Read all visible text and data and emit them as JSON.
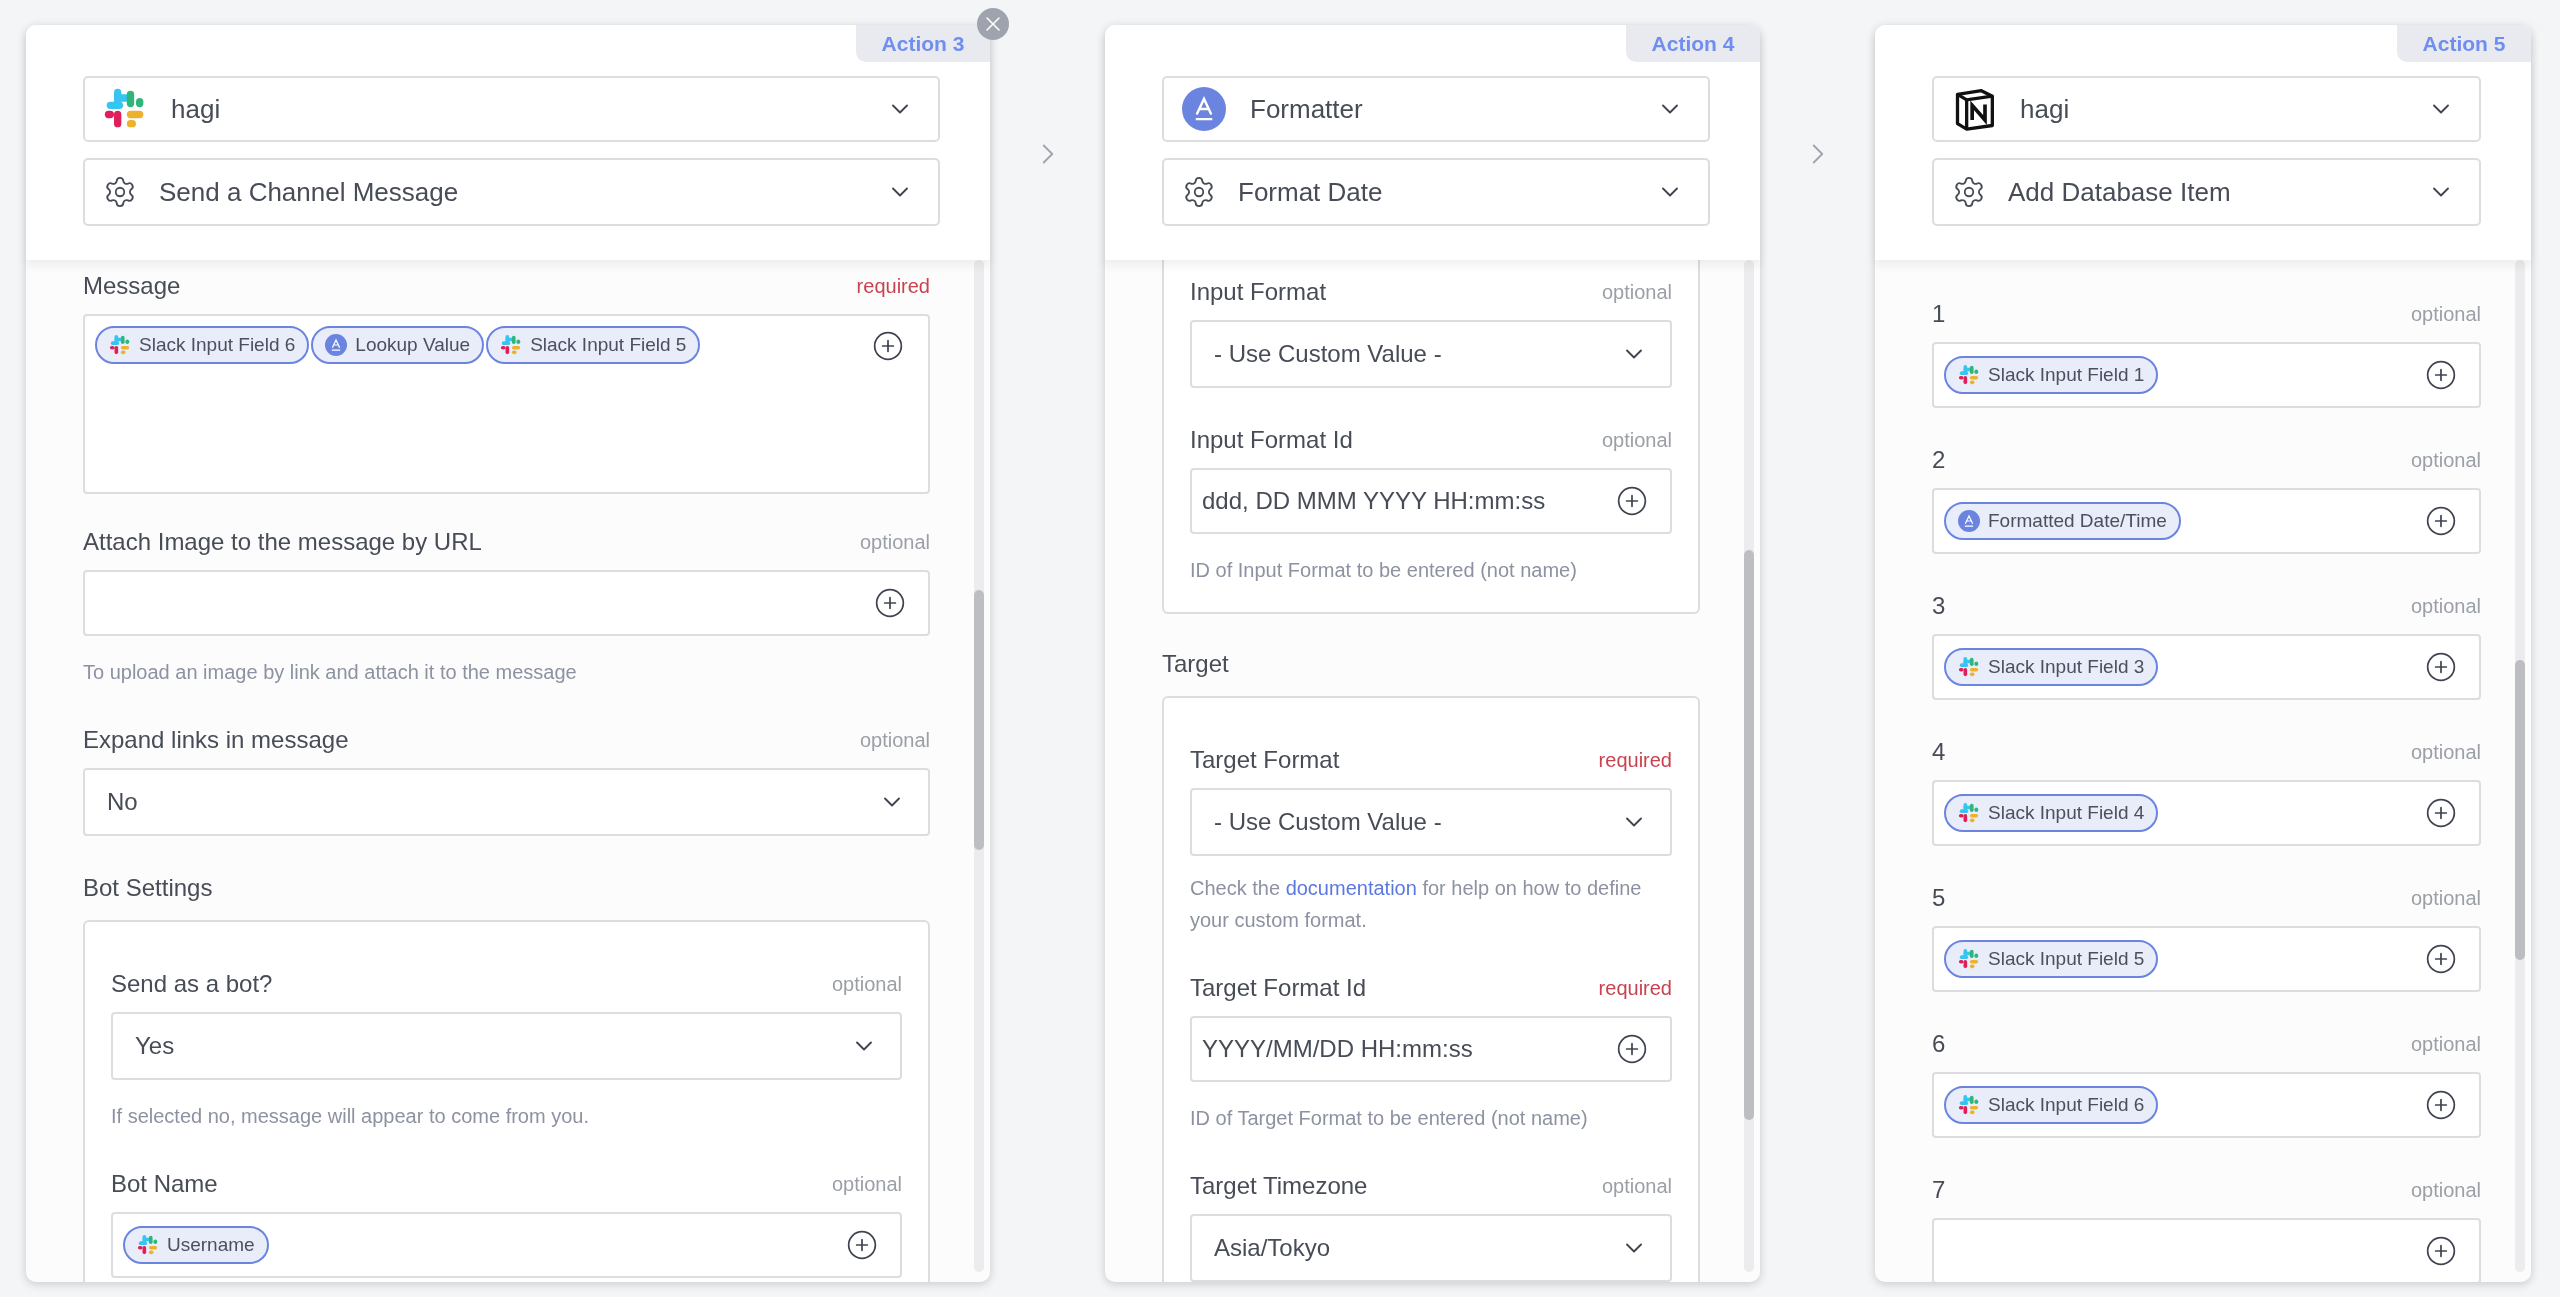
{
  "panels": [
    {
      "action": "Action 3",
      "closable": true,
      "app": {
        "kind": "slack",
        "name": "hagi"
      },
      "event": "Send a Channel Message",
      "fields": [
        {
          "kind": "tokens",
          "label": "Message",
          "required": true,
          "badge": "required",
          "tokens": [
            {
              "kind": "slack",
              "text": "Slack Input Field 6"
            },
            {
              "kind": "formatter",
              "text": "Lookup Value"
            },
            {
              "kind": "slack",
              "text": "Slack Input Field 5"
            }
          ]
        },
        {
          "kind": "input",
          "label": "Attach Image to the message by URL",
          "required": false,
          "badge": "optional",
          "hint": "To upload an image by link and attach it to the message"
        },
        {
          "kind": "select",
          "label": "Expand links in message",
          "required": false,
          "badge": "optional",
          "value": "No"
        },
        {
          "kind": "group",
          "title": "Bot Settings",
          "children": [
            {
              "kind": "select",
              "label": "Send as a bot?",
              "required": false,
              "badge": "optional",
              "value": "Yes",
              "hint": "If selected no, message will appear to come from you."
            },
            {
              "kind": "input",
              "label": "Bot Name",
              "required": false,
              "badge": "optional",
              "tokens": [
                {
                  "kind": "slack",
                  "text": "Username"
                }
              ]
            }
          ]
        }
      ]
    },
    {
      "action": "Action 4",
      "closable": false,
      "app": {
        "kind": "formatter",
        "name": "Formatter"
      },
      "event": "Format Date",
      "fields": [
        {
          "kind": "group",
          "children": [
            {
              "kind": "select",
              "label": "Input Format",
              "required": false,
              "badge": "optional",
              "value": "- Use Custom Value -"
            },
            {
              "kind": "input",
              "label": "Input Format Id",
              "required": false,
              "badge": "optional",
              "value": "ddd, DD MMM YYYY HH:mm:ss",
              "hint": "ID of Input Format to be entered (not name)"
            }
          ]
        },
        {
          "kind": "group",
          "title": "Target",
          "children": [
            {
              "kind": "select",
              "label": "Target Format",
              "required": true,
              "badge": "required",
              "value": "- Use Custom Value -",
              "hint_link": {
                "before": "Check the",
                "link": "documentation",
                "after": "for help on how to define your custom format."
              }
            },
            {
              "kind": "input",
              "label": "Target Format Id",
              "required": true,
              "badge": "required",
              "value": "YYYY/MM/DD HH:mm:ss",
              "hint": "ID of Target Format to be entered (not name)"
            },
            {
              "kind": "select",
              "label": "Target Timezone",
              "required": false,
              "badge": "optional",
              "value": "Asia/Tokyo"
            }
          ]
        }
      ]
    },
    {
      "action": "Action 5",
      "closable": false,
      "app": {
        "kind": "notion",
        "name": "hagi"
      },
      "event": "Add Database Item",
      "fields": [
        {
          "kind": "input",
          "label": "1",
          "required": false,
          "badge": "optional",
          "tokens": [
            {
              "kind": "slack",
              "text": "Slack Input Field 1"
            }
          ]
        },
        {
          "kind": "input",
          "label": "2",
          "required": false,
          "badge": "optional",
          "tokens": [
            {
              "kind": "formatter",
              "text": "Formatted Date/Time"
            }
          ]
        },
        {
          "kind": "input",
          "label": "3",
          "required": false,
          "badge": "optional",
          "tokens": [
            {
              "kind": "slack",
              "text": "Slack Input Field 3"
            }
          ]
        },
        {
          "kind": "input",
          "label": "4",
          "required": false,
          "badge": "optional",
          "tokens": [
            {
              "kind": "slack",
              "text": "Slack Input Field 4"
            }
          ]
        },
        {
          "kind": "input",
          "label": "5",
          "required": false,
          "badge": "optional",
          "tokens": [
            {
              "kind": "slack",
              "text": "Slack Input Field 5"
            }
          ]
        },
        {
          "kind": "input",
          "label": "6",
          "required": false,
          "badge": "optional",
          "tokens": [
            {
              "kind": "slack",
              "text": "Slack Input Field 6"
            }
          ]
        },
        {
          "kind": "input",
          "label": "7",
          "required": false,
          "badge": "optional"
        }
      ]
    }
  ]
}
